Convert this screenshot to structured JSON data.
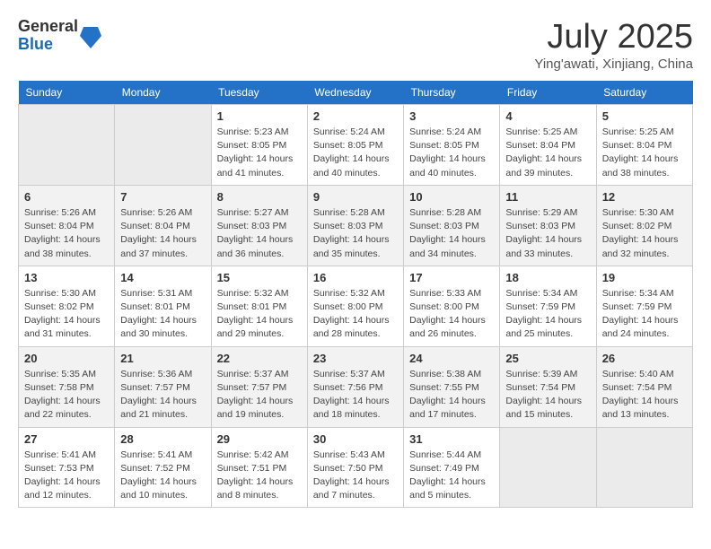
{
  "header": {
    "logo": {
      "general": "General",
      "blue": "Blue"
    },
    "title": "July 2025",
    "location": "Ying'awati, Xinjiang, China"
  },
  "weekdays": [
    "Sunday",
    "Monday",
    "Tuesday",
    "Wednesday",
    "Thursday",
    "Friday",
    "Saturday"
  ],
  "weeks": [
    {
      "row": 1,
      "days": [
        {
          "num": "",
          "info": ""
        },
        {
          "num": "",
          "info": ""
        },
        {
          "num": "1",
          "info": "Sunrise: 5:23 AM\nSunset: 8:05 PM\nDaylight: 14 hours and 41 minutes."
        },
        {
          "num": "2",
          "info": "Sunrise: 5:24 AM\nSunset: 8:05 PM\nDaylight: 14 hours and 40 minutes."
        },
        {
          "num": "3",
          "info": "Sunrise: 5:24 AM\nSunset: 8:05 PM\nDaylight: 14 hours and 40 minutes."
        },
        {
          "num": "4",
          "info": "Sunrise: 5:25 AM\nSunset: 8:04 PM\nDaylight: 14 hours and 39 minutes."
        },
        {
          "num": "5",
          "info": "Sunrise: 5:25 AM\nSunset: 8:04 PM\nDaylight: 14 hours and 38 minutes."
        }
      ]
    },
    {
      "row": 2,
      "days": [
        {
          "num": "6",
          "info": "Sunrise: 5:26 AM\nSunset: 8:04 PM\nDaylight: 14 hours and 38 minutes."
        },
        {
          "num": "7",
          "info": "Sunrise: 5:26 AM\nSunset: 8:04 PM\nDaylight: 14 hours and 37 minutes."
        },
        {
          "num": "8",
          "info": "Sunrise: 5:27 AM\nSunset: 8:03 PM\nDaylight: 14 hours and 36 minutes."
        },
        {
          "num": "9",
          "info": "Sunrise: 5:28 AM\nSunset: 8:03 PM\nDaylight: 14 hours and 35 minutes."
        },
        {
          "num": "10",
          "info": "Sunrise: 5:28 AM\nSunset: 8:03 PM\nDaylight: 14 hours and 34 minutes."
        },
        {
          "num": "11",
          "info": "Sunrise: 5:29 AM\nSunset: 8:03 PM\nDaylight: 14 hours and 33 minutes."
        },
        {
          "num": "12",
          "info": "Sunrise: 5:30 AM\nSunset: 8:02 PM\nDaylight: 14 hours and 32 minutes."
        }
      ]
    },
    {
      "row": 3,
      "days": [
        {
          "num": "13",
          "info": "Sunrise: 5:30 AM\nSunset: 8:02 PM\nDaylight: 14 hours and 31 minutes."
        },
        {
          "num": "14",
          "info": "Sunrise: 5:31 AM\nSunset: 8:01 PM\nDaylight: 14 hours and 30 minutes."
        },
        {
          "num": "15",
          "info": "Sunrise: 5:32 AM\nSunset: 8:01 PM\nDaylight: 14 hours and 29 minutes."
        },
        {
          "num": "16",
          "info": "Sunrise: 5:32 AM\nSunset: 8:00 PM\nDaylight: 14 hours and 28 minutes."
        },
        {
          "num": "17",
          "info": "Sunrise: 5:33 AM\nSunset: 8:00 PM\nDaylight: 14 hours and 26 minutes."
        },
        {
          "num": "18",
          "info": "Sunrise: 5:34 AM\nSunset: 7:59 PM\nDaylight: 14 hours and 25 minutes."
        },
        {
          "num": "19",
          "info": "Sunrise: 5:34 AM\nSunset: 7:59 PM\nDaylight: 14 hours and 24 minutes."
        }
      ]
    },
    {
      "row": 4,
      "days": [
        {
          "num": "20",
          "info": "Sunrise: 5:35 AM\nSunset: 7:58 PM\nDaylight: 14 hours and 22 minutes."
        },
        {
          "num": "21",
          "info": "Sunrise: 5:36 AM\nSunset: 7:57 PM\nDaylight: 14 hours and 21 minutes."
        },
        {
          "num": "22",
          "info": "Sunrise: 5:37 AM\nSunset: 7:57 PM\nDaylight: 14 hours and 19 minutes."
        },
        {
          "num": "23",
          "info": "Sunrise: 5:37 AM\nSunset: 7:56 PM\nDaylight: 14 hours and 18 minutes."
        },
        {
          "num": "24",
          "info": "Sunrise: 5:38 AM\nSunset: 7:55 PM\nDaylight: 14 hours and 17 minutes."
        },
        {
          "num": "25",
          "info": "Sunrise: 5:39 AM\nSunset: 7:54 PM\nDaylight: 14 hours and 15 minutes."
        },
        {
          "num": "26",
          "info": "Sunrise: 5:40 AM\nSunset: 7:54 PM\nDaylight: 14 hours and 13 minutes."
        }
      ]
    },
    {
      "row": 5,
      "days": [
        {
          "num": "27",
          "info": "Sunrise: 5:41 AM\nSunset: 7:53 PM\nDaylight: 14 hours and 12 minutes."
        },
        {
          "num": "28",
          "info": "Sunrise: 5:41 AM\nSunset: 7:52 PM\nDaylight: 14 hours and 10 minutes."
        },
        {
          "num": "29",
          "info": "Sunrise: 5:42 AM\nSunset: 7:51 PM\nDaylight: 14 hours and 8 minutes."
        },
        {
          "num": "30",
          "info": "Sunrise: 5:43 AM\nSunset: 7:50 PM\nDaylight: 14 hours and 7 minutes."
        },
        {
          "num": "31",
          "info": "Sunrise: 5:44 AM\nSunset: 7:49 PM\nDaylight: 14 hours and 5 minutes."
        },
        {
          "num": "",
          "info": ""
        },
        {
          "num": "",
          "info": ""
        }
      ]
    }
  ]
}
